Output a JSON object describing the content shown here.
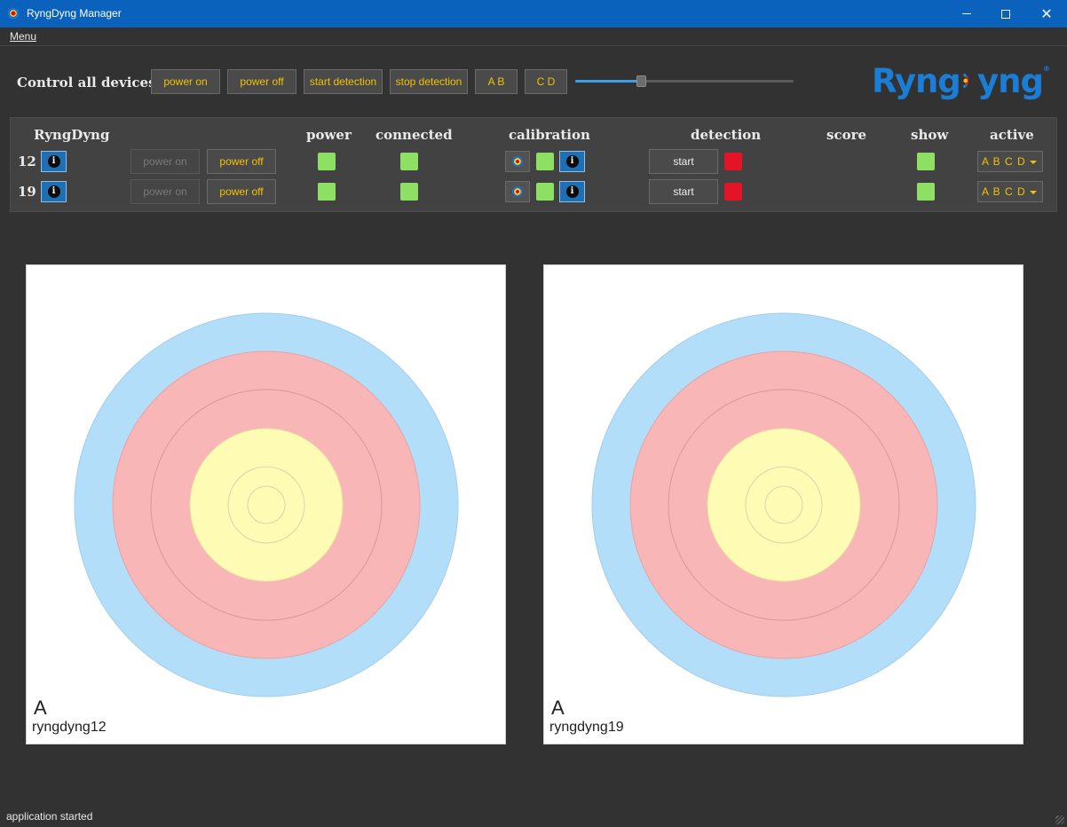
{
  "window": {
    "title": "RyngDyng Manager"
  },
  "menu": {
    "label": "Menu"
  },
  "control": {
    "label": "Control all devices:",
    "buttons": [
      "power on",
      "power off",
      "start detection",
      "stop detection",
      "A B",
      "C D"
    ],
    "slider_level": 0.3
  },
  "logo": {
    "text_left": "Ryng",
    "text_right": "yng",
    "registered": "®"
  },
  "headers": {
    "ryngdyng": "RyngDyng",
    "power": "power",
    "connected": "connected",
    "calibration": "calibration",
    "detection": "detection",
    "score": "score",
    "show": "show",
    "active": "active"
  },
  "devices": [
    {
      "id": "12",
      "power_on": "power on",
      "power_off": "power off",
      "detection_button": "start",
      "active": "A B C D"
    },
    {
      "id": "19",
      "power_on": "power on",
      "power_off": "power off",
      "detection_button": "start",
      "active": "A B C D"
    }
  ],
  "targets": [
    {
      "letter": "A",
      "name": "ryngdyng12"
    },
    {
      "letter": "A",
      "name": "ryngdyng19"
    }
  ],
  "colors": {
    "target_blue": "#b3defa",
    "target_red": "#f9b6b7",
    "target_yellow": "#fefcb4",
    "indicator_green": "#8ee065",
    "indicator_red": "#e31328",
    "button_text": "#f2c200",
    "titlebar": "#0b62bd"
  },
  "status": {
    "text": "application started"
  }
}
